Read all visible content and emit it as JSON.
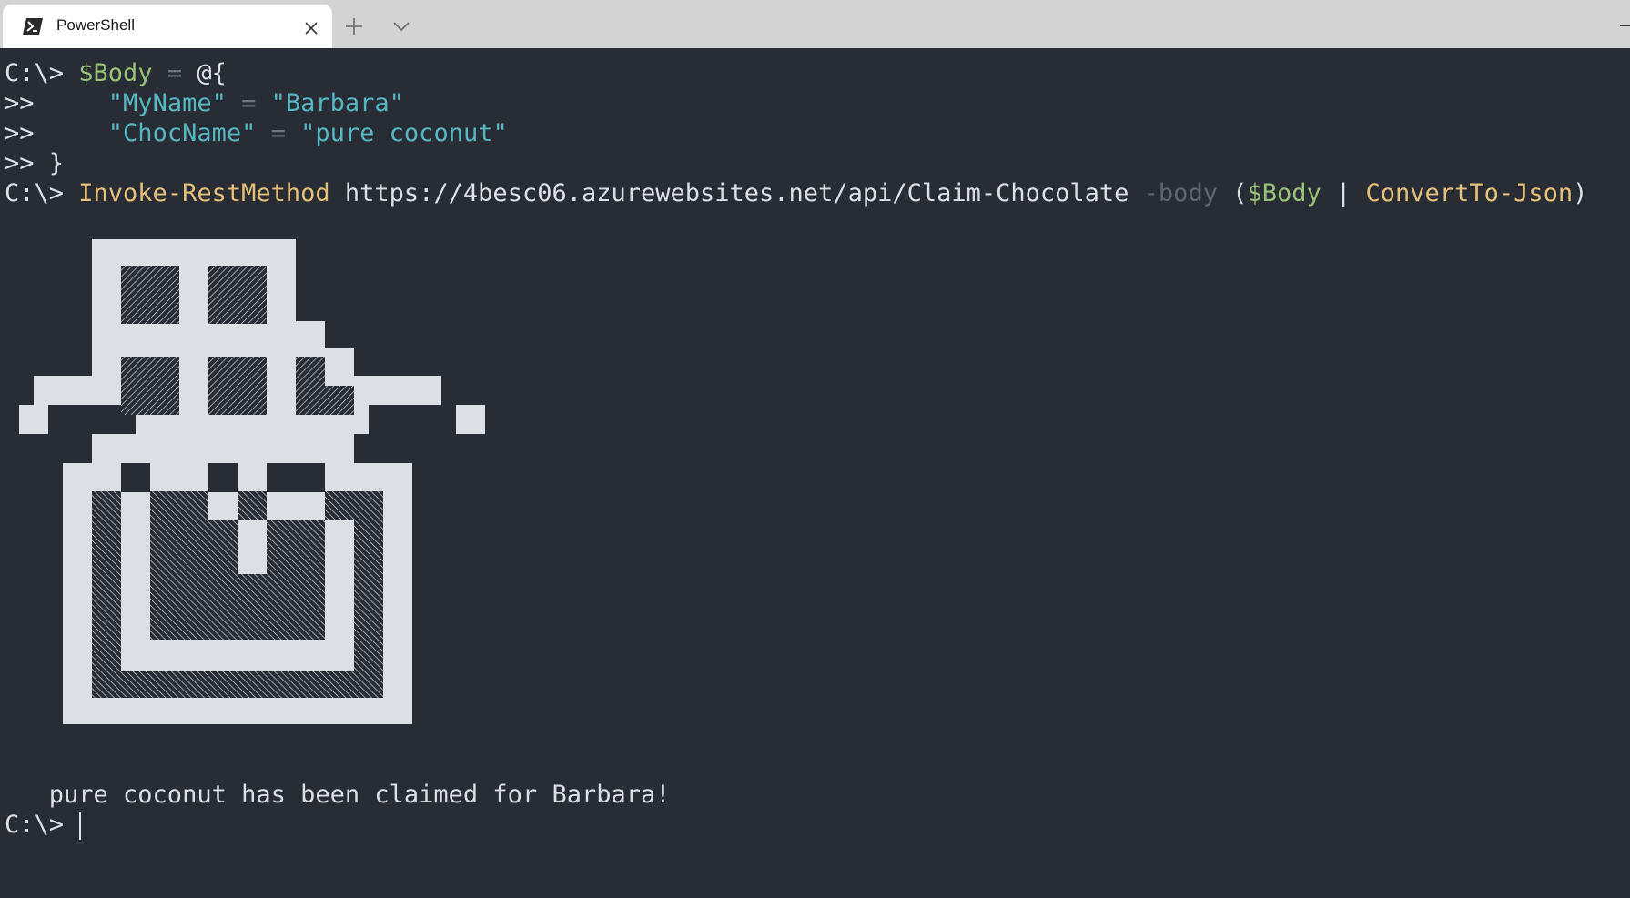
{
  "tab": {
    "title": "PowerShell",
    "icon": "powershell-icon",
    "close_icon": "close-icon"
  },
  "tabbar": {
    "new_tab_icon": "plus-icon",
    "dropdown_icon": "chevron-down-icon"
  },
  "colors": {
    "background": "#282c34",
    "foreground": "#dcdfe4",
    "variable": "#98c379",
    "string": "#56b6c2",
    "command": "#e5c07b",
    "operator": "#6f7683",
    "art_light": "#dcdfe4",
    "art_dark": "#282c34"
  },
  "terminal": {
    "line1": {
      "prompt": "C:\\> ",
      "var": "$Body",
      "op": " = ",
      "rest": "@{"
    },
    "line2": {
      "prompt": ">>     ",
      "key": "\"MyName\"",
      "op": " = ",
      "value": "\"Barbara\""
    },
    "line3": {
      "prompt": ">>     ",
      "key": "\"ChocName\"",
      "op": " = ",
      "value": "\"pure coconut\""
    },
    "line4": {
      "prompt": ">> }"
    },
    "line5": {
      "prompt": "C:\\> ",
      "cmd": "Invoke-RestMethod",
      "url": " https://4besc06.azurewebsites.net/api/Claim-Chocolate ",
      "param": "-body",
      "open": " (",
      "var": "$Body",
      "pipe": " | ",
      "cmd2": "ConvertTo-Json",
      "close": ")"
    },
    "art_name": "chocolate-bar-ascii-art",
    "result": "   pure coconut has been claimed for Barbara!",
    "final_prompt": "C:\\> "
  }
}
